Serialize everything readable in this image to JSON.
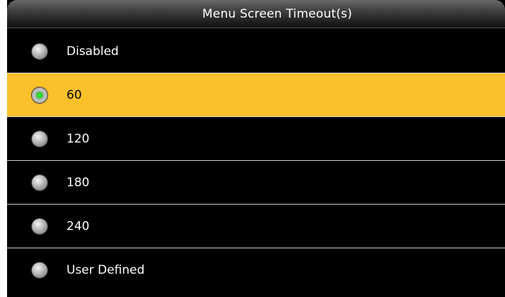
{
  "header": {
    "title": "Menu Screen Timeout(s)"
  },
  "options": [
    {
      "label": "Disabled",
      "selected": false
    },
    {
      "label": "60",
      "selected": true
    },
    {
      "label": "120",
      "selected": false
    },
    {
      "label": "180",
      "selected": false
    },
    {
      "label": "240",
      "selected": false
    },
    {
      "label": "User Defined",
      "selected": false
    }
  ],
  "colors": {
    "highlight": "#fcc02b",
    "background": "#000000",
    "radio_checked_dot": "#22cc22"
  }
}
